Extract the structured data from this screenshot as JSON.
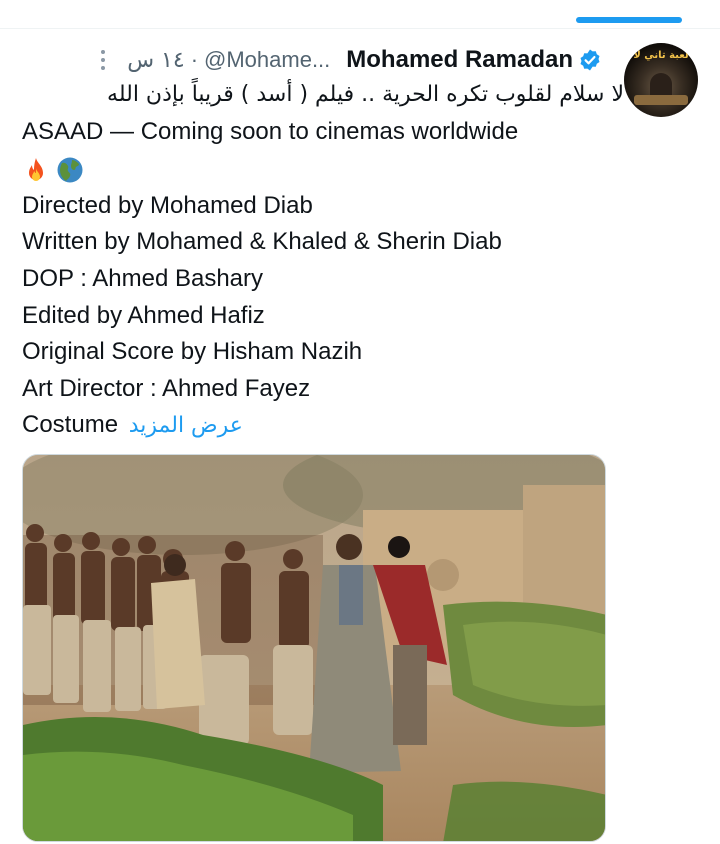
{
  "tweet": {
    "display_name": "Mohamed Ramadan",
    "handle": "@Mohame...",
    "time": "١٤ س",
    "separator": "·",
    "verified": true,
    "text_lines": [
      "لا سلام لقلوب تكره الحرية .. فيلم ( أسد ) قريباً بإذن الله",
      "ASAAD — Coming soon to cinemas worldwide",
      "Directed by Mohamed Diab",
      "Written by Mohamed & Khaled & Sherin Diab",
      "DOP : Ahmed Bashary",
      "Edited by Ahmed Hafiz",
      "Original Score by Hisham Nazih",
      "Art Director : Ahmed Fayez",
      "Costume"
    ],
    "show_more": "عرض المزيد",
    "emojis": [
      "fire-emoji",
      "globe-emoji"
    ]
  },
  "avatar": {
    "banner_text": "لعبة تاني لا"
  },
  "colors": {
    "accent": "#1d9bf0",
    "text": "#0f1419",
    "muted": "#536471"
  },
  "icons": [
    "more-vertical-icon",
    "verified-badge-icon"
  ]
}
